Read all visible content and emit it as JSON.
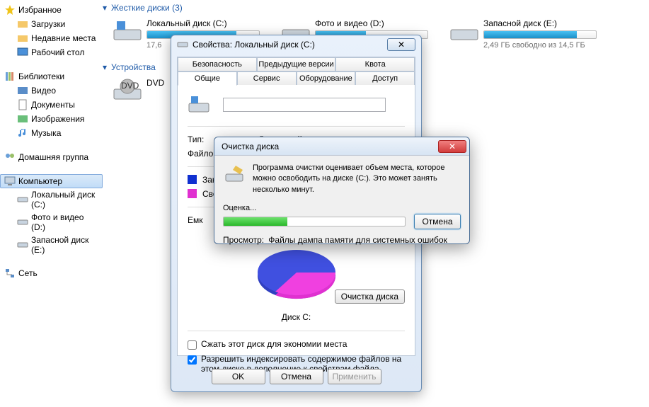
{
  "sidebar": {
    "favorites": {
      "label": "Избранное",
      "items": [
        {
          "label": "Загрузки"
        },
        {
          "label": "Недавние места"
        },
        {
          "label": "Рабочий стол"
        }
      ]
    },
    "libraries": {
      "label": "Библиотеки",
      "items": [
        {
          "label": "Видео"
        },
        {
          "label": "Документы"
        },
        {
          "label": "Изображения"
        },
        {
          "label": "Музыка"
        }
      ]
    },
    "homegroup": {
      "label": "Домашняя группа"
    },
    "computer": {
      "label": "Компьютер",
      "items": [
        {
          "label": "Локальный диск (C:)"
        },
        {
          "label": "Фото и видео (D:)"
        },
        {
          "label": "Запасной диск (E:)"
        }
      ]
    },
    "network": {
      "label": "Сеть"
    }
  },
  "main": {
    "hdd_header": "Жесткие диски (3)",
    "removable_header": "Устройства",
    "drives": [
      {
        "title": "Локальный диск (C:)",
        "sub": "17,6",
        "fill": 80
      },
      {
        "title": "Фото и видео (D:)",
        "sub": "",
        "fill": 45
      },
      {
        "title": "Запасной диск (E:)",
        "sub": "2,49 ГБ свободно из 14,5 ГБ",
        "fill": 83
      }
    ],
    "dvd": "DVD"
  },
  "props": {
    "title": "Свойства: Локальный диск (C:)",
    "tabs_top": [
      "Безопасность",
      "Предыдущие версии",
      "Квота"
    ],
    "tabs_bottom": [
      "Общие",
      "Сервис",
      "Оборудование",
      "Доступ"
    ],
    "active_tab": "Общие",
    "name_value": "",
    "type_label": "Тип:",
    "type_value": "Локальный диск",
    "fs_label": "Файлов",
    "used_label": "Зан",
    "free_label": "Сво",
    "cap_label": "Емк",
    "drive_c": "Диск C:",
    "cleanup_btn": "Очистка диска",
    "compress": "Сжать этот диск для экономии места",
    "index": "Разрешить индексировать содержимое файлов на этом диске в дополнение к свойствам файла",
    "ok": "OK",
    "cancel": "Отмена",
    "apply": "Применить"
  },
  "cleanup": {
    "title": "Очистка диска",
    "message": "Программа очистки оценивает объем места, которое можно освободить на диске  (C:). Это может занять несколько минут.",
    "eval": "Оценка...",
    "cancel": "Отмена",
    "view_label": "Просмотр:",
    "view_value": "Файлы дампа памяти для системных ошибок"
  }
}
